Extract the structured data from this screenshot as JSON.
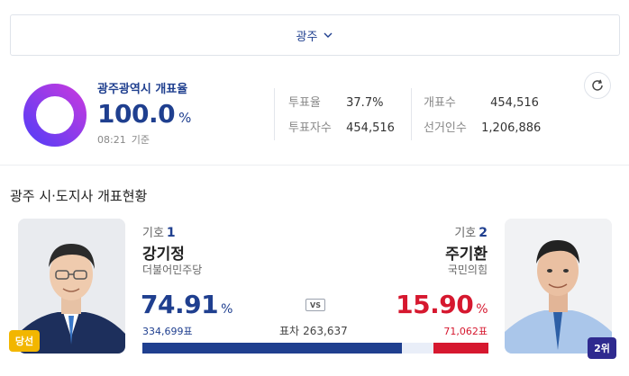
{
  "region_selector": {
    "label": "광주",
    "icon": "chevron-down-icon"
  },
  "summary": {
    "title": "광주광역시 개표율",
    "rate": "100.0",
    "rate_unit": "%",
    "progress": 100.0,
    "time": "08:21",
    "time_suffix": "기준",
    "stats": [
      {
        "label": "투표율",
        "value": "37.7%"
      },
      {
        "label": "투표자수",
        "value": "454,516"
      },
      {
        "label": "개표수",
        "value": "454,516"
      },
      {
        "label": "선거인수",
        "value": "1,206,886"
      }
    ],
    "refresh_icon": "refresh-icon"
  },
  "section": {
    "title": "광주 시·도지사 개표현황"
  },
  "candidates": [
    {
      "number_label": "기호",
      "number": "1",
      "name": "강기정",
      "party": "더불어민주당",
      "percent": "74.91",
      "percent_unit": "%",
      "votes": "334,699표",
      "badge": "당선",
      "color": "#1f3f8f",
      "share": 74.91
    },
    {
      "number_label": "기호",
      "number": "2",
      "name": "주기환",
      "party": "국민의힘",
      "percent": "15.90",
      "percent_unit": "%",
      "votes": "71,062표",
      "badge": "2위",
      "color": "#d6182f",
      "share": 15.9
    }
  ],
  "comparison": {
    "vs_label": "VS",
    "margin_label": "표차",
    "margin_value": "263,637"
  },
  "colors": {
    "accent": "#1f3f8f",
    "winner_badge": "#f2b600",
    "rank_badge": "#2f2a8f",
    "ring_gradient_start": "#5b3df5",
    "ring_gradient_end": "#c03ae0",
    "other_share": "#e9eef8"
  }
}
